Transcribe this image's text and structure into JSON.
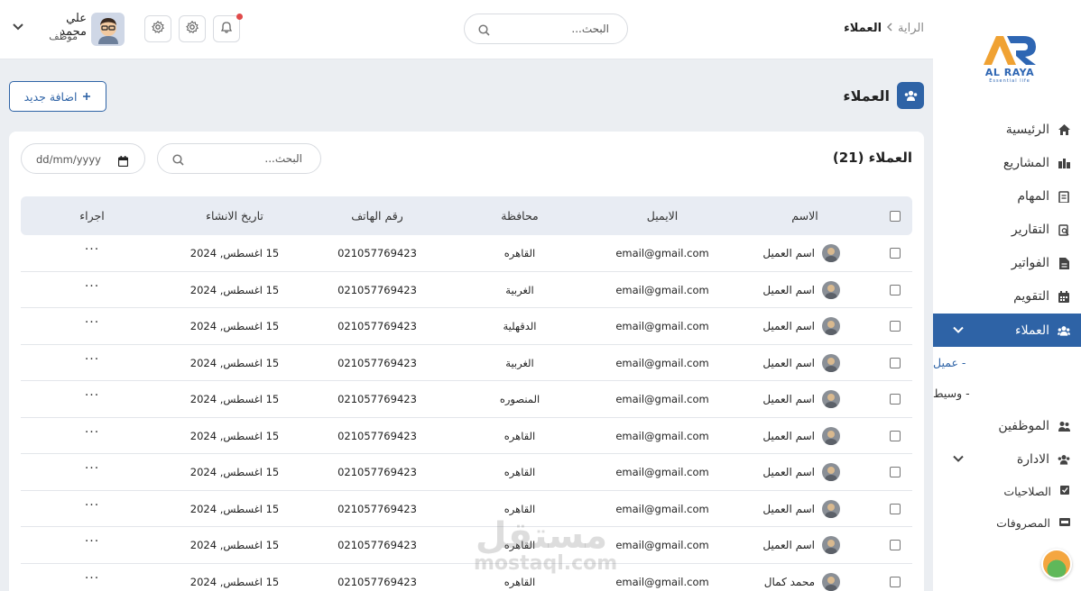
{
  "brand": {
    "name": "AL RAYA",
    "tagline": "Essential life",
    "mark": "AR"
  },
  "colors": {
    "primary": "#2e63a6",
    "background": "#ebeef2",
    "table_header": "#e8ecf3",
    "notification": "#e04a4a"
  },
  "sidebar": {
    "items": [
      {
        "label": "الرئيسية",
        "icon": "home-icon"
      },
      {
        "label": "المشاريع",
        "icon": "projects-icon"
      },
      {
        "label": "المهام",
        "icon": "tasks-icon"
      },
      {
        "label": "التقارير",
        "icon": "reports-icon"
      },
      {
        "label": "الفواتير",
        "icon": "invoices-icon"
      },
      {
        "label": "التقويم",
        "icon": "calendar-icon"
      },
      {
        "label": "العملاء",
        "icon": "users-icon",
        "active": true
      },
      {
        "label": "الموظفين",
        "icon": "employees-icon"
      },
      {
        "label": "الادارة",
        "icon": "admin-icon"
      }
    ],
    "clients_sub": [
      "- عميل",
      "- وسيط"
    ],
    "admin_sub": [
      {
        "label": "الصلاحيات",
        "icon": "permissions-icon"
      },
      {
        "label": "المصروفات",
        "icon": "expenses-icon"
      }
    ]
  },
  "topbar": {
    "breadcrumb": {
      "home": "الراية",
      "current": "العملاء"
    },
    "search_placeholder": "البحث...",
    "user": {
      "name": "علي محمد",
      "role": "موظف"
    }
  },
  "page": {
    "title": "العملاء",
    "add_button": "اضافة جديد"
  },
  "table_card": {
    "title": "العملاء (21)",
    "search_placeholder": "البحث...",
    "date_placeholder": "dd/mm/yyyy",
    "columns": [
      "الاسم",
      "الايميل",
      "محافظة",
      "رقم الهاتف",
      "تاريخ الانشاء",
      "اجراء"
    ],
    "rows": [
      {
        "name": "اسم العميل",
        "email": "email@gmail.com",
        "gov": "القاهره",
        "phone": "021057769423",
        "date": "15 اغسطس, 2024",
        "action": "···"
      },
      {
        "name": "اسم العميل",
        "email": "email@gmail.com",
        "gov": "الغربية",
        "phone": "021057769423",
        "date": "15 اغسطس, 2024",
        "action": "···"
      },
      {
        "name": "اسم العميل",
        "email": "email@gmail.com",
        "gov": "الدقهلية",
        "phone": "021057769423",
        "date": "15 اغسطس, 2024",
        "action": "···"
      },
      {
        "name": "اسم العميل",
        "email": "email@gmail.com",
        "gov": "الغربية",
        "phone": "021057769423",
        "date": "15 اغسطس, 2024",
        "action": "···"
      },
      {
        "name": "اسم العميل",
        "email": "email@gmail.com",
        "gov": "المنصوره",
        "phone": "021057769423",
        "date": "15 اغسطس, 2024",
        "action": "···"
      },
      {
        "name": "اسم العميل",
        "email": "email@gmail.com",
        "gov": "القاهره",
        "phone": "021057769423",
        "date": "15 اغسطس, 2024",
        "action": "···"
      },
      {
        "name": "اسم العميل",
        "email": "email@gmail.com",
        "gov": "القاهره",
        "phone": "021057769423",
        "date": "15 اغسطس, 2024",
        "action": "···"
      },
      {
        "name": "اسم العميل",
        "email": "email@gmail.com",
        "gov": "القاهره",
        "phone": "021057769423",
        "date": "15 اغسطس, 2024",
        "action": "···"
      },
      {
        "name": "اسم العميل",
        "email": "email@gmail.com",
        "gov": "القاهره",
        "phone": "021057769423",
        "date": "15 اغسطس, 2024",
        "action": "···"
      },
      {
        "name": "محمد كمال",
        "email": "email@gmail.com",
        "gov": "القاهره",
        "phone": "021057769423",
        "date": "15 اغسطس, 2024",
        "action": "···"
      }
    ]
  },
  "watermark": {
    "arabic": "مستقل",
    "latin": "mostaql.com"
  }
}
